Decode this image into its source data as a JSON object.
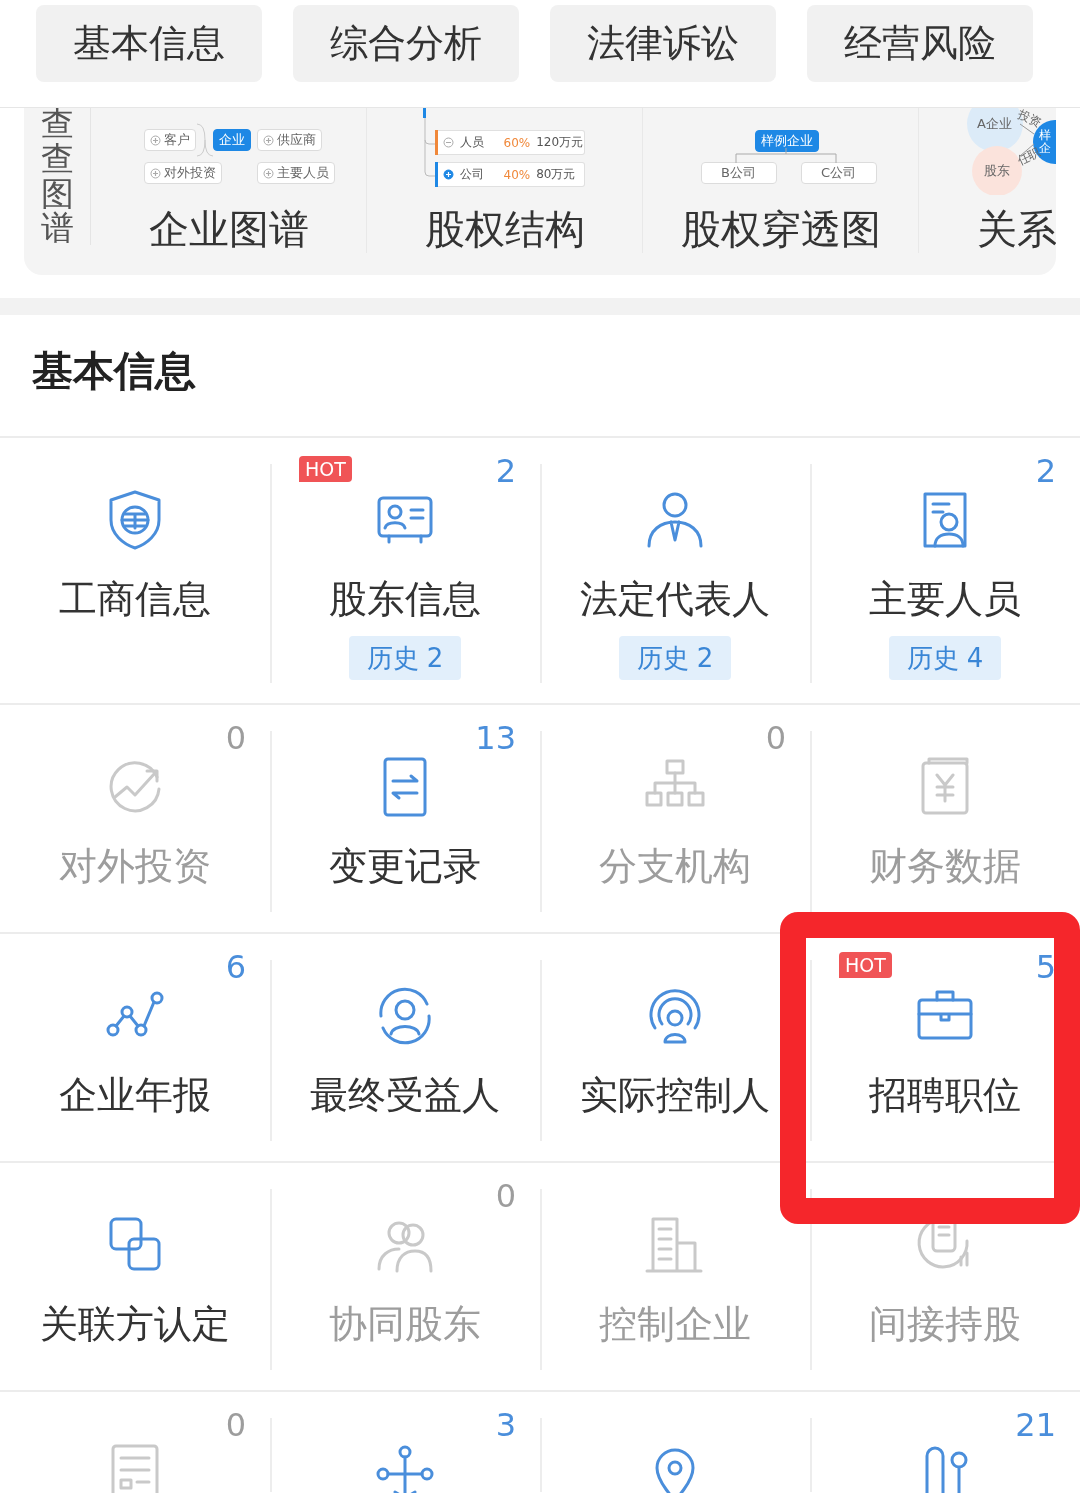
{
  "tabs": [
    {
      "label": "基本信息",
      "selected": false
    },
    {
      "label": "综合分析",
      "selected": false
    },
    {
      "label": "法律诉讼",
      "selected": false
    },
    {
      "label": "经营风险",
      "selected": false
    }
  ],
  "graph_strip": {
    "title": "查查图谱",
    "cards": [
      {
        "kind": "mindmap",
        "title": "企业图谱",
        "preview": {
          "center": "企业",
          "left": "客户",
          "right": "供应商",
          "bottom_left": "对外投资",
          "bottom_right": "主要人员"
        }
      },
      {
        "kind": "equity",
        "title": "股权结构",
        "preview": {
          "rows": [
            {
              "name": "人员",
              "share": "60%",
              "amount": "120万元",
              "expanded": true,
              "color": "#f0883a"
            },
            {
              "name": "公司",
              "share": "40%",
              "amount": "80万元",
              "expanded": false,
              "color": "#1e88e5"
            }
          ]
        }
      },
      {
        "kind": "penetration",
        "title": "股权穿透图",
        "preview": {
          "center": "样例企业",
          "children": [
            "B公司",
            "C公司"
          ]
        }
      },
      {
        "kind": "relation",
        "title": "关系",
        "preview": {
          "nodes": [
            "A企业",
            "股东",
            "样企"
          ],
          "edges": [
            "投资",
            "任职"
          ]
        }
      }
    ]
  },
  "section": {
    "title": "基本信息"
  },
  "rows": [
    [
      {
        "label": "工商信息",
        "disabled": false,
        "highlighted": false
      },
      {
        "label": "股东信息",
        "count": "2",
        "history": "历史 2",
        "badge": "HOT",
        "disabled": false,
        "highlighted": false
      },
      {
        "label": "法定代表人",
        "history": "历史 2",
        "disabled": false,
        "highlighted": false
      },
      {
        "label": "主要人员",
        "count": "2",
        "history": "历史 4",
        "disabled": false,
        "highlighted": false
      }
    ],
    [
      {
        "label": "对外投资",
        "count": "0",
        "disabled": true,
        "highlighted": false
      },
      {
        "label": "变更记录",
        "count": "13",
        "disabled": false,
        "highlighted": false
      },
      {
        "label": "分支机构",
        "count": "0",
        "disabled": true,
        "highlighted": false
      },
      {
        "label": "财务数据",
        "disabled": true,
        "highlighted": false
      }
    ],
    [
      {
        "label": "企业年报",
        "count": "6",
        "disabled": false,
        "highlighted": false
      },
      {
        "label": "最终受益人",
        "disabled": false,
        "highlighted": false
      },
      {
        "label": "实际控制人",
        "disabled": false,
        "highlighted": false
      },
      {
        "label": "招聘职位",
        "count": "5",
        "badge": "HOT",
        "disabled": false,
        "highlighted": true
      }
    ],
    [
      {
        "label": "关联方认定",
        "disabled": false,
        "highlighted": false
      },
      {
        "label": "协同股东",
        "count": "0",
        "disabled": true,
        "highlighted": false
      },
      {
        "label": "控制企业",
        "disabled": true,
        "highlighted": false
      },
      {
        "label": "间接持股",
        "disabled": true,
        "highlighted": false
      }
    ],
    [
      {
        "count": "0",
        "disabled": true,
        "highlighted": false
      },
      {
        "count": "3",
        "disabled": false,
        "highlighted": false
      },
      {
        "disabled": false,
        "highlighted": false
      },
      {
        "count": "21",
        "disabled": false,
        "highlighted": false
      }
    ]
  ]
}
